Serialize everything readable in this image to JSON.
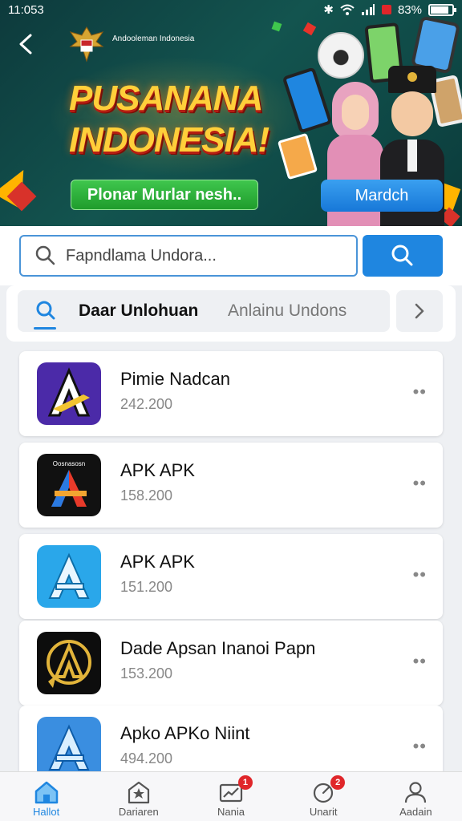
{
  "status_bar": {
    "time": "11:053",
    "battery": "83%",
    "battery_level": 0.83
  },
  "banner": {
    "emblem_text": "Andooleman Indonesia",
    "headline_line1": "PUSANANA",
    "headline_line2": "INDONESIA!",
    "promo_button": "Plonar Murlar nesh..",
    "match_button": "Mardch"
  },
  "search": {
    "placeholder": "Fapndlama Undora..."
  },
  "tabs": {
    "active": "Daar  Unlohuan",
    "inactive": "Anlainu Undons"
  },
  "apps": [
    {
      "name": "Pimie Nadcan",
      "count": "242.200",
      "icon": "a-logo-purple-icon"
    },
    {
      "name": "APK APK",
      "count": "158.200",
      "icon": "a-logo-black-icon",
      "icon_caption": "Oosnasosn"
    },
    {
      "name": "APK APK",
      "count": "151.200",
      "icon": "a-logo-lightblue-icon"
    },
    {
      "name": "Dade Apsan Inanoi Papn",
      "count": "153.200",
      "icon": "a-logo-gold-icon"
    },
    {
      "name": "Apko APKo Niint",
      "count": "494.200",
      "icon": "a-logo-blue-icon"
    }
  ],
  "bottom_nav": [
    {
      "label": "Hallot",
      "icon": "home-icon",
      "active": true
    },
    {
      "label": "Dariaren",
      "icon": "store-icon",
      "active": false
    },
    {
      "label": "Nania",
      "icon": "chart-icon",
      "badge": "1",
      "active": false
    },
    {
      "label": "Unarit",
      "icon": "gauge-icon",
      "badge": "2",
      "active": false
    },
    {
      "label": "Aadain",
      "icon": "user-icon",
      "active": false
    }
  ],
  "colors": {
    "accent": "#1f86e0",
    "banner_bg": "#13544f",
    "headline": "#ffcf3a",
    "promo_green": "#2aad38",
    "badge_red": "#e0262a"
  }
}
